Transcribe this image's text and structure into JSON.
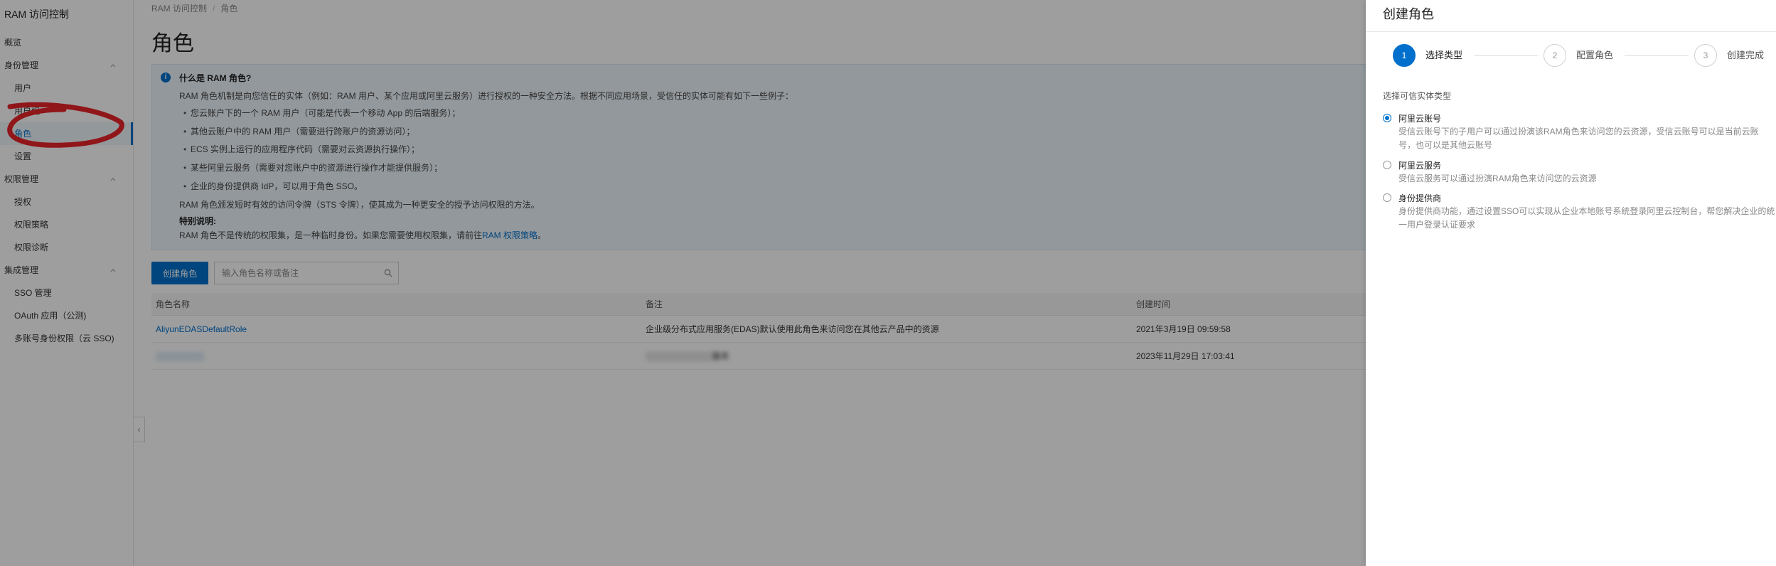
{
  "sidebar": {
    "title": "RAM 访问控制",
    "overview": "概览",
    "groups": [
      {
        "label": "身份管理",
        "items": [
          "用户",
          "用户组",
          "角色",
          "设置"
        ]
      },
      {
        "label": "权限管理",
        "items": [
          "授权",
          "权限策略",
          "权限诊断"
        ]
      },
      {
        "label": "集成管理",
        "items": [
          "SSO 管理",
          "OAuth 应用（公测)",
          "多账号身份权限（云 SSO)"
        ]
      }
    ],
    "active_item": "角色"
  },
  "breadcrumb": {
    "root": "RAM 访问控制",
    "current": "角色"
  },
  "page_title": "角色",
  "notice": {
    "title": "什么是 RAM 角色?",
    "intro": "RAM 角色机制是向您信任的实体（例如：RAM 用户、某个应用或阿里云服务）进行授权的一种安全方法。根据不同应用场景，受信任的实体可能有如下一些例子：",
    "bullets": [
      "您云账户下的一个 RAM 用户（可能是代表一个移动 App 的后端服务）；",
      "其他云账户中的 RAM 用户（需要进行跨账户的资源访问）；",
      "ECS 实例上运行的应用程序代码（需要对云资源执行操作）；",
      "某些阿里云服务（需要对您账户中的资源进行操作才能提供服务）；",
      "企业的身份提供商 IdP，可以用于角色 SSO。"
    ],
    "para": "RAM 角色颁发短时有效的访问令牌（STS 令牌），使其成为一种更安全的授予访问权限的方法。",
    "special_title": "特别说明:",
    "special_text": "RAM 角色不是传统的权限集，是一种临时身份。如果您需要使用权限集，请前往",
    "special_link": "RAM 权限策略",
    "special_end": "。"
  },
  "toolbar": {
    "create_label": "创建角色",
    "search_placeholder": "输入角色名称或备注"
  },
  "table": {
    "headers": [
      "角色名称",
      "备注",
      "创建时间"
    ],
    "rows": [
      {
        "name": "AliyunEDASDefaultRole",
        "note": "企业级分布式应用服务(EDAS)默认使用此角色来访问您在其他云产品中的资源",
        "created": "2021年3月19日 09:59:58"
      },
      {
        "name": "░░░░░░░░",
        "note": "░░░░░░░░░░░服务",
        "created": "2023年11月29日 17:03:41"
      }
    ]
  },
  "drawer": {
    "title": "创建角色",
    "steps": [
      {
        "num": "1",
        "label": "选择类型"
      },
      {
        "num": "2",
        "label": "配置角色"
      },
      {
        "num": "3",
        "label": "创建完成"
      }
    ],
    "section_label": "选择可信实体类型",
    "options": [
      {
        "title": "阿里云账号",
        "desc": "受信云账号下的子用户可以通过扮演该RAM角色来访问您的云资源，受信云账号可以是当前云账号，也可以是其他云账号",
        "checked": true
      },
      {
        "title": "阿里云服务",
        "desc": "受信云服务可以通过扮演RAM角色来访问您的云资源",
        "checked": false
      },
      {
        "title": "身份提供商",
        "desc": "身份提供商功能，通过设置SSO可以实现从企业本地账号系统登录阿里云控制台，帮您解决企业的统一用户登录认证要求",
        "checked": false
      }
    ]
  },
  "colors": {
    "accent": "#0070cc",
    "annotation": "#e8242a"
  },
  "icons": [
    "chevron-up-icon",
    "chevron-left-icon",
    "info-icon",
    "search-icon"
  ]
}
